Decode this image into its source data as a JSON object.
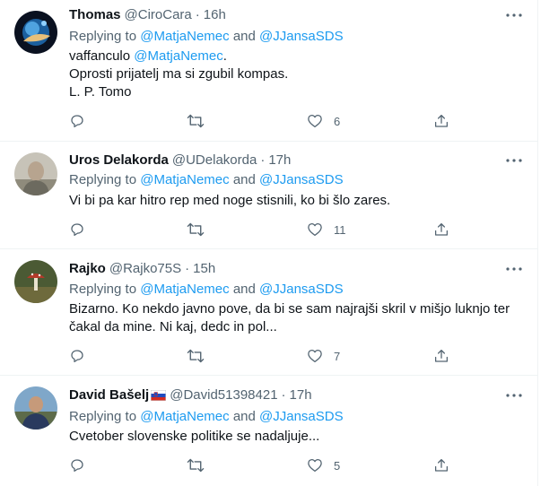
{
  "reply_prefix": "Replying to",
  "reply_and": "and",
  "tweets": [
    {
      "name": "Thomas",
      "handle": "@CiroCara",
      "dot": "·",
      "time": "16h",
      "mention1": "@MatjaNemec",
      "mention2": "@JJansaSDS",
      "body": {
        "line1_prefix": "vaffanculo ",
        "line1_mention": "@MatjaNemec",
        "line1_suffix": ".",
        "line2": "Oprosti prijatelj ma si zgubil kompas.",
        "line3": "L. P. Tomo"
      },
      "likes": "6"
    },
    {
      "name": "Uros Delakorda",
      "handle": "@UDelakorda",
      "dot": "·",
      "time": "17h",
      "mention1": "@MatjaNemec",
      "mention2": "@JJansaSDS",
      "body": {
        "line1": "Vi bi pa kar hitro rep med noge stisnili, ko bi šlo zares."
      },
      "likes": "11"
    },
    {
      "name": "Rajko",
      "handle": "@Rajko75S",
      "dot": "·",
      "time": "15h",
      "mention1": "@MatjaNemec",
      "mention2": "@JJansaSDS",
      "body": {
        "line1": "Bizarno. Ko nekdo javno pove, da bi se sam najrajši skril v mišjo luknjo ter",
        "line2": "čakal da mine. Ni kaj, dedc in pol..."
      },
      "likes": "7"
    },
    {
      "name": "David Bašelj",
      "handle": "@David51398421",
      "dot": "·",
      "time": "17h",
      "mention1": "@MatjaNemec",
      "mention2": "@JJansaSDS",
      "body": {
        "line1": "Cvetober slovenske politike se nadaljuje..."
      },
      "likes": "5"
    }
  ],
  "icons": {
    "more": "more-horizontal-icon",
    "reply": "reply-icon",
    "retweet": "retweet-icon",
    "like": "heart-icon",
    "share": "share-icon",
    "flag": "slovenia-flag-icon"
  },
  "colors": {
    "text": "#0f1419",
    "secondary": "#536471",
    "link": "#1d9bf0",
    "divider": "#eff3f4"
  }
}
